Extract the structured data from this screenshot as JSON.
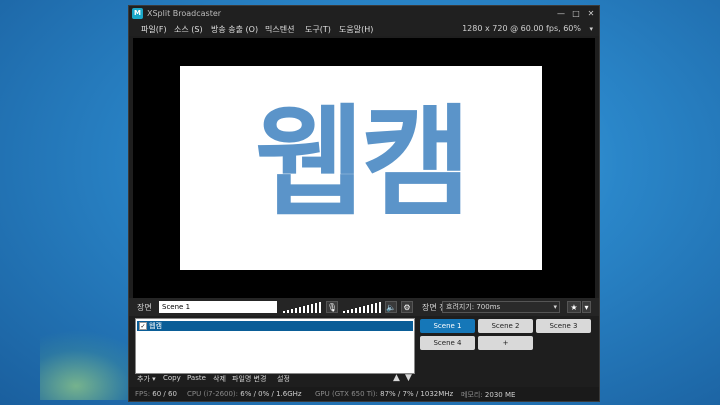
{
  "window": {
    "title": "XSplit Broadcaster",
    "icon_letter": "M",
    "controls": {
      "minimize": "—",
      "maximize": "□",
      "close": "✕"
    }
  },
  "menu": {
    "items": [
      "파일(F)",
      "소스 (S)",
      "방송 송출 (O)",
      "믹스텐션",
      "도구(T)",
      "도움말(H)"
    ],
    "resolution": "1280 x 720 @ 60.00 fps, 60%",
    "resolution_arrow": "▾"
  },
  "preview": {
    "text": "웹캠",
    "text_color": "#5b94c9"
  },
  "scene_bar": {
    "label": "장면",
    "scene_name": "Scene 1",
    "mic_icon": "🎙",
    "speaker_icon": "🔈",
    "gear_icon": "⚙",
    "transition_label": "장면 전환",
    "transition_value": "흐려지기: 700ms",
    "transition_arrow": "▾",
    "fav_icon": "★",
    "fav_arrow": "▾"
  },
  "sources": {
    "items": [
      {
        "label": "웹캠",
        "checked": "✓"
      }
    ],
    "tools": [
      "추가 ▾",
      "Copy",
      "Paste",
      "삭제",
      "파일명 변경",
      "설정"
    ],
    "up": "▲",
    "down": "▼"
  },
  "scenes": {
    "buttons": [
      "Scene 1",
      "Scene 2",
      "Scene 3",
      "Scene 4",
      "+"
    ],
    "active_color": "#1577b8"
  },
  "status": {
    "fps_label": "FPS:",
    "fps_value": "60 / 60",
    "cpu_label": "CPU (i7-2600):",
    "cpu_value": "6% / 0% / 1.6GHz",
    "gpu_label": "GPU (GTX 650 Ti):",
    "gpu_value": "87% / 7% / 1032MHz",
    "mem_label": "메모리:",
    "mem_value": "2030 ME"
  }
}
